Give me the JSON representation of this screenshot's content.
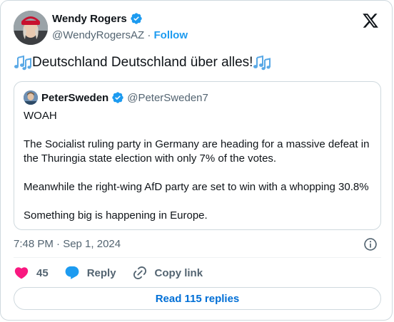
{
  "author": {
    "name": "Wendy Rogers",
    "handle": "@WendyRogersAZ",
    "separator": "·",
    "follow_label": "Follow"
  },
  "tweet": {
    "text": "Deutschland Deutschland über alles!",
    "timestamp": "7:48 PM · Sep 1, 2024"
  },
  "quoted_tweet": {
    "name": "PeterSweden",
    "handle": "@PeterSweden7",
    "paragraphs": [
      "WOAH",
      "The Socialist ruling party in Germany are heading for a massive defeat in the Thuringia state election with only 7% of the votes.",
      "Meanwhile the right-wing AfD party are set to win with a whopping 30.8%",
      "Something big is happening in Europe."
    ]
  },
  "actions": {
    "like_count": "45",
    "reply_label": "Reply",
    "copy_link_label": "Copy link"
  },
  "read_replies_label": "Read 115 replies",
  "colors": {
    "accent": "#1d9bf0",
    "like": "#f91880",
    "link_button": "#006fd6",
    "secondary_text": "#536471",
    "border": "#cfd9de"
  },
  "icons": [
    "verified-badge-icon",
    "x-logo-icon",
    "musical-notes-icon",
    "info-icon",
    "heart-icon",
    "reply-bubble-icon",
    "link-icon"
  ]
}
